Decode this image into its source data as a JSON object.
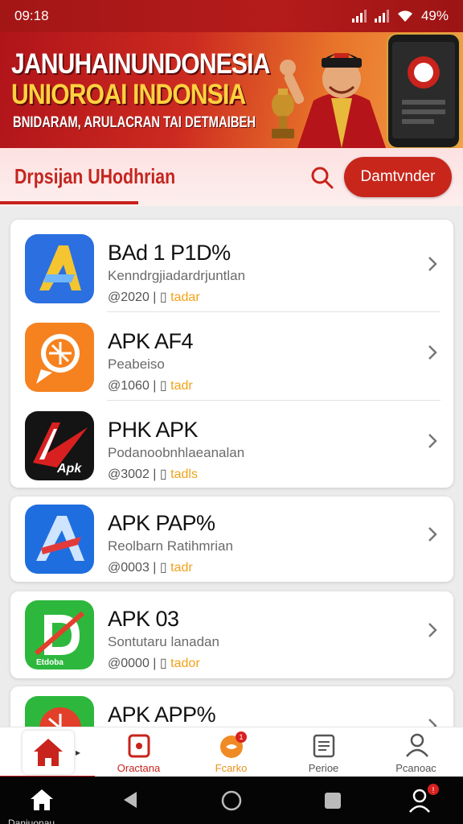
{
  "status_bar": {
    "time": "09:18",
    "battery": "49%"
  },
  "banner": {
    "title": "JANUHAINUNDONESIA",
    "subtitle": "UNIOROAI INDONSIA",
    "tagline": "BNIDARAM, ARULACRAN TAI DETMAIBEH"
  },
  "header": {
    "title": "Drpsijan UHodhrian",
    "download_label": "Damtvnder"
  },
  "apps": [
    {
      "name": "BAd 1 P1D%",
      "desc": "Kenndrgjiadardrjuntlan",
      "year": "@2020",
      "sep": "|",
      "tag": "tadar",
      "icon": "abstract-a-icon",
      "colors": [
        "#2a6fd9",
        "#f4c531"
      ]
    },
    {
      "name": "APK AF4",
      "desc": "Peabeiso",
      "year": "@1060",
      "sep": "|",
      "tag": "tadr",
      "icon": "orange-chat-icon",
      "colors": [
        "#f5821f",
        "#ffffff"
      ]
    },
    {
      "name": "PHK APK",
      "desc": "Podanoobnhlaeanalan",
      "year": "@3002",
      "sep": "|",
      "tag": "tadls",
      "icon": "apk-arrow-icon",
      "colors": [
        "#111111",
        "#d92020"
      ]
    },
    {
      "name": "APK PAP%",
      "desc": "Reolbarn Ratihmrian",
      "year": "@0003",
      "sep": "|",
      "tag": "tadr",
      "icon": "blue-a-icon",
      "colors": [
        "#1f6ee0",
        "#e23a3a"
      ]
    },
    {
      "name": "APK 03",
      "desc": "Sontutaru lanadan",
      "year": "@0000",
      "sep": "|",
      "tag": "tador",
      "icon": "green-d-icon",
      "colors": [
        "#2db83d",
        "#ffffff"
      ]
    },
    {
      "name": "APK APP%",
      "desc": "",
      "year": "",
      "sep": "",
      "tag": "",
      "icon": "green-shield-icon",
      "colors": [
        "#2db83d",
        "#e2402b"
      ]
    }
  ],
  "bottom_nav": [
    {
      "label": "",
      "icon": "home-icon"
    },
    {
      "label": "Oractana",
      "icon": "card-icon"
    },
    {
      "label": "Fcarko",
      "icon": "badge-icon",
      "badge": "1"
    },
    {
      "label": "Perioe",
      "icon": "document-icon"
    },
    {
      "label": "Pcanoac",
      "icon": "user-icon"
    }
  ],
  "system_bar": {
    "label": "Daniuonau",
    "notification_badge": "!"
  }
}
